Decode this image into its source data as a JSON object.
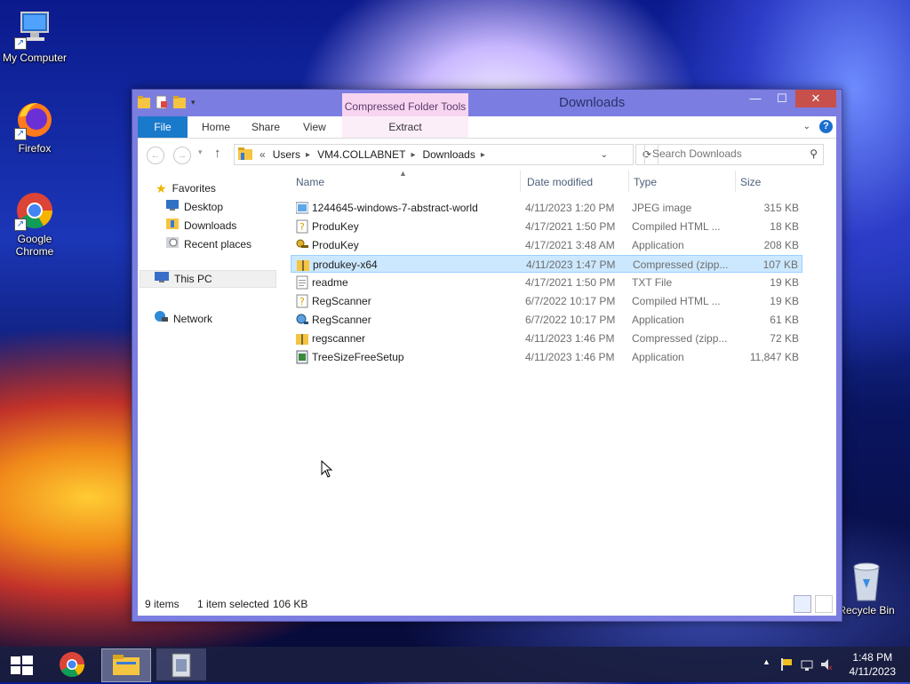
{
  "desktop": {
    "icons": [
      {
        "label": "My Computer"
      },
      {
        "label": "Firefox"
      },
      {
        "label": "Google Chrome"
      },
      {
        "label": "Recycle Bin"
      }
    ]
  },
  "window": {
    "title": "Downloads",
    "contextual_tab_group": "Compressed Folder Tools",
    "ribbon_tabs": [
      "File",
      "Home",
      "Share",
      "View",
      "Extract"
    ],
    "address": {
      "overflow": "«",
      "crumbs": [
        "Users",
        "VM4.COLLABNET",
        "Downloads"
      ]
    },
    "search_placeholder": "Search Downloads",
    "nav": {
      "favorites": "Favorites",
      "desktop": "Desktop",
      "downloads": "Downloads",
      "recent": "Recent places",
      "this_pc": "This PC",
      "network": "Network"
    },
    "columns": {
      "name": "Name",
      "date": "Date modified",
      "type": "Type",
      "size": "Size"
    },
    "files": [
      {
        "name": "1244645-windows-7-abstract-world",
        "date": "4/11/2023 1:20 PM",
        "type": "JPEG image",
        "size": "315 KB",
        "icon": "image-file-icon"
      },
      {
        "name": "ProduKey",
        "date": "4/17/2021 1:50 PM",
        "type": "Compiled HTML ...",
        "size": "18 KB",
        "icon": "help-file-icon"
      },
      {
        "name": "ProduKey",
        "date": "4/17/2021 3:48 AM",
        "type": "Application",
        "size": "208 KB",
        "icon": "key-app-icon"
      },
      {
        "name": "produkey-x64",
        "date": "4/11/2023 1:47 PM",
        "type": "Compressed (zipp...",
        "size": "107 KB",
        "icon": "zip-folder-icon",
        "selected": true
      },
      {
        "name": "readme",
        "date": "4/17/2021 1:50 PM",
        "type": "TXT File",
        "size": "19 KB",
        "icon": "text-file-icon"
      },
      {
        "name": "RegScanner",
        "date": "6/7/2022 10:17 PM",
        "type": "Compiled HTML ...",
        "size": "19 KB",
        "icon": "help-file-icon"
      },
      {
        "name": "RegScanner",
        "date": "6/7/2022 10:17 PM",
        "type": "Application",
        "size": "61 KB",
        "icon": "scanner-app-icon"
      },
      {
        "name": "regscanner",
        "date": "4/11/2023 1:46 PM",
        "type": "Compressed (zipp...",
        "size": "72 KB",
        "icon": "zip-folder-icon"
      },
      {
        "name": "TreeSizeFreeSetup",
        "date": "4/11/2023 1:46 PM",
        "type": "Application",
        "size": "11,847 KB",
        "icon": "installer-icon"
      }
    ],
    "status": {
      "items": "9 items",
      "selected": "1 item selected",
      "size": "106 KB"
    }
  },
  "taskbar": {
    "time": "1:48 PM",
    "date": "4/11/2023"
  },
  "colors": {
    "accent": "#1979ca",
    "selection": "#cce8ff",
    "window_frame": "#7b7ee0",
    "context_tab": "#f7d5f0"
  }
}
